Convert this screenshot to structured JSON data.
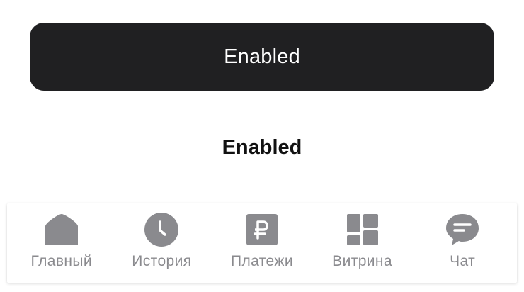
{
  "buttons": {
    "primary_label": "Enabled",
    "text_label": "Enabled"
  },
  "colors": {
    "primary_bg": "#202022",
    "tab_icon": "#8a8a8e",
    "tab_label": "#8a8a8e"
  },
  "tabbar": {
    "items": [
      {
        "label": "Главный",
        "icon": "home-icon"
      },
      {
        "label": "История",
        "icon": "clock-icon"
      },
      {
        "label": "Платежи",
        "icon": "ruble-icon"
      },
      {
        "label": "Витрина",
        "icon": "grid-icon"
      },
      {
        "label": "Чат",
        "icon": "chat-icon"
      }
    ]
  }
}
